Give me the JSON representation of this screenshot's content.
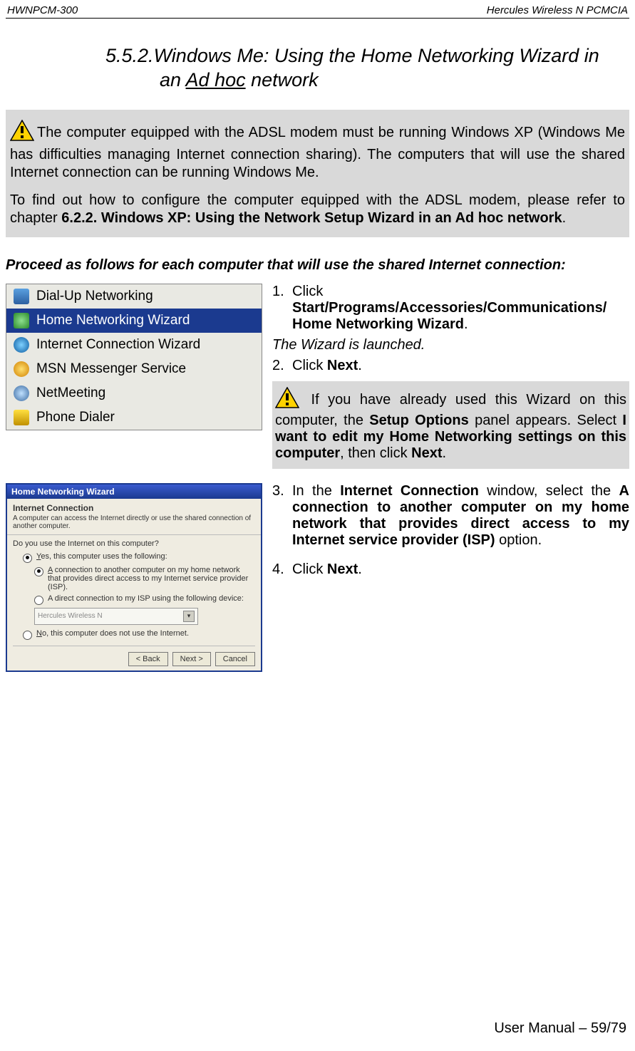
{
  "header": {
    "left": "HWNPCM-300",
    "right": "Hercules Wireless N PCMCIA"
  },
  "section": {
    "number": "5.5.2.",
    "title_line1": "Windows Me:  Using  the  Home  Networking  Wizard  in",
    "title_line2_pre": "an ",
    "title_line2_u": "Ad hoc",
    "title_line2_post": " network"
  },
  "box1": {
    "p1": "The  computer  equipped  with  the  ADSL  modem  must  be  running  Windows  XP  (Windows Me  has difficulties  managing  Internet  connection  sharing).    The  computers  that  will  use  the  shared  Internet connection can be running Windows Me.",
    "p2_pre": "To find out how to configure the computer equipped with the ADSL modem, please refer to chapter ",
    "p2_bold": "6.2.2. Windows XP: Using the Network Setup Wizard in an Ad hoc network",
    "p2_post": "."
  },
  "subhead": "Proceed as follows for each computer that will use the shared Internet connection:",
  "menu": {
    "items": [
      "Dial-Up Networking",
      "Home Networking Wizard",
      "Internet Connection Wizard",
      "MSN Messenger Service",
      "NetMeeting",
      "Phone Dialer"
    ],
    "selected_index": 1
  },
  "steps1": {
    "n1": "1.",
    "s1a": "Click ",
    "s1b": "Start/Programs/Accessories/Communications/ Home Networking Wizard",
    "s1c": ".",
    "wizlaunched": "The Wizard is launched.",
    "n2": "2.",
    "s2a": "Click ",
    "s2b": "Next",
    "s2c": "."
  },
  "box2": {
    "pre": " If you have already used this Wizard on this computer, the ",
    "b1": "Setup Options",
    "mid1": " panel appears. Select ",
    "b2": "I want to edit my Home  Networking  settings  on  this  computer",
    "mid2": ",  then  click ",
    "b3": "Next",
    "post": "."
  },
  "dialog": {
    "title": "Home Networking Wizard",
    "head": "Internet Connection",
    "sub": "A computer can access the Internet directly or use the shared connection of another computer.",
    "question": "Do you use the Internet on this computer?",
    "opt_yes": "Yes, this computer uses the following:",
    "opt_a_u": "A",
    "opt_a_rest": " connection to another computer on my home network that provides direct access to my Internet service provider (ISP).",
    "opt_b": "A direct connection to my ISP using the following device:",
    "combo": "Hercules Wireless N",
    "opt_no_u": "N",
    "opt_no_rest": "o, this computer does not use the Internet.",
    "btn_back": "< Back",
    "btn_next": "Next >",
    "btn_cancel": "Cancel"
  },
  "steps2": {
    "n3": "3.",
    "s3a": "In  the  ",
    "s3b": "Internet  Connection",
    "s3c": "  window,  select  the  ",
    "s3d": "A connection to another computer on my home network that  provides  direct  access  to  my  Internet  service provider (ISP)",
    "s3e": " option.",
    "n4": "4.",
    "s4a": "Click ",
    "s4b": "Next",
    "s4c": "."
  },
  "footer": "User Manual – 59/79"
}
